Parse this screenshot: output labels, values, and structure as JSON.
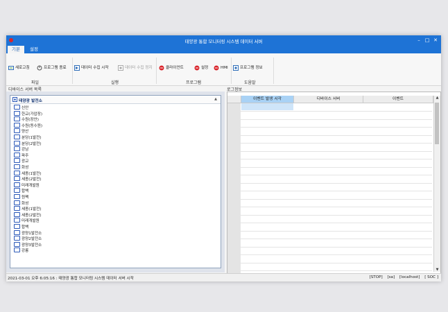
{
  "window": {
    "title": "태양광 통합 모니터링 시스템 데이터 서버"
  },
  "ribbon_tabs": [
    "기본",
    "설정"
  ],
  "ribbon": {
    "buttons": [
      {
        "label": "새로고침",
        "icon": "refresh-icon"
      },
      {
        "label": "프로그램 종료",
        "icon": "power-icon"
      },
      {
        "label": "데이터 수집 시작",
        "icon": "data-start-icon"
      },
      {
        "label": "데이터 수집 정지",
        "icon": "data-stop-icon",
        "disabled": true
      },
      {
        "label": "클라이언트",
        "icon": "client-icon"
      },
      {
        "label": "설정",
        "icon": "settings-icon"
      },
      {
        "label": "HMI",
        "icon": "hmi-icon"
      },
      {
        "label": "프로그램 정보",
        "icon": "info-icon"
      }
    ],
    "groups": [
      "파일",
      "실행",
      "프로그램",
      "도움말"
    ]
  },
  "left_panel": {
    "title": "디바이스 서버 목록",
    "root": "태양광 발전소",
    "items": [
      "신안",
      "한교(가압장)",
      "수원(장안)",
      "수원(동수원)",
      "양산",
      "분당(1발전)",
      "분당(2발전)",
      "강남",
      "파주",
      "광교",
      "화성",
      "세종(1발전)",
      "세종(2발전)",
      "미래개발원",
      "합백",
      "원팩",
      "화성",
      "세종(1발전)",
      "세종(2발전)",
      "미래개발원",
      "합백",
      "광양1발전소",
      "광양2발전소",
      "광양3발전소",
      "강릉"
    ]
  },
  "right_panel": {
    "title": "로그정보",
    "columns": [
      "이벤트 발생 시각",
      "디바이스 서버",
      "이벤트"
    ]
  },
  "statusbar": {
    "message": "2021-03-01 오후 6:05:16 : 태양광 통합 모니터링 시스템 데이터 서버 시작",
    "items": [
      "[STOP]",
      "[sa]",
      "[localhost]",
      "[ SOC ]"
    ]
  },
  "colors": {
    "titlebar": "#1e73d6",
    "accent_red": "#d9252b",
    "selected_header": "#a9d2f5"
  }
}
